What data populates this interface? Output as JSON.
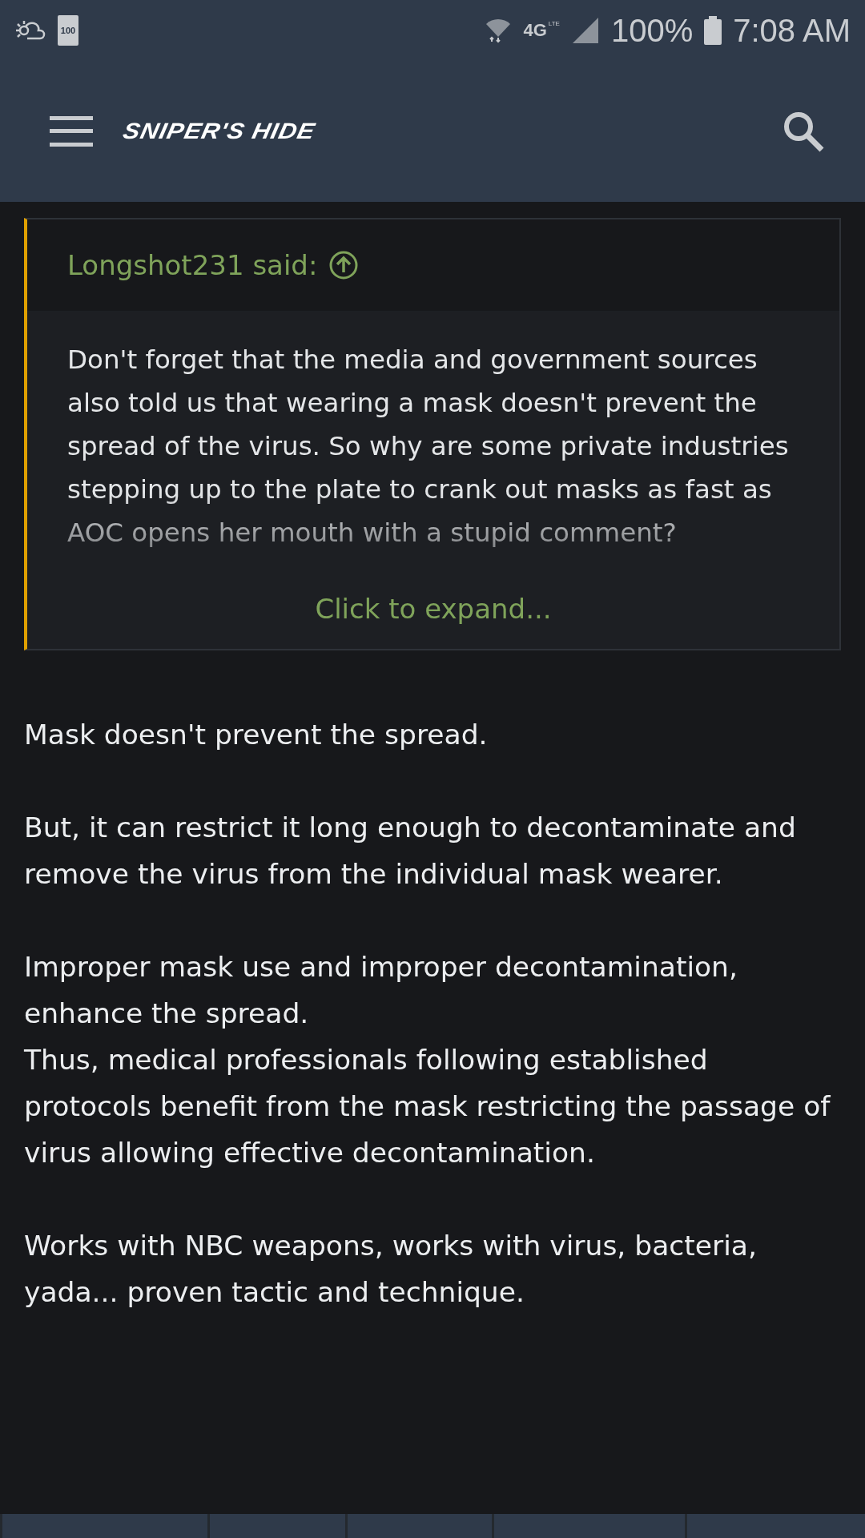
{
  "status_bar": {
    "battery_badge": "100",
    "network": "4G",
    "network_sub": "LTE",
    "battery": "100%",
    "time": "7:08 AM"
  },
  "header": {
    "logo": "SNIPER'S HIDE"
  },
  "quote": {
    "author": "Longshot231 said:",
    "text": "Don't forget that the media and government sources also told us that wearing a mask doesn't prevent the spread of the virus. So why are some private industries stepping up to the plate to crank out masks as fast as AOC opens her mouth with a stupid comment?",
    "expand": "Click to expand..."
  },
  "post": {
    "paragraphs": [
      [
        "Mask doesn't prevent the spread."
      ],
      [
        "But, it can restrict it long enough to decontaminate and remove the virus from the individual mask wearer."
      ],
      [
        "Improper mask use and improper decontamination, enhance the spread.",
        "Thus, medical professionals following established protocols benefit from the mask restricting the passage of virus allowing effective decontamination."
      ],
      [
        "Works with NBC weapons, works with virus, bacteria, yada... proven tactic and technique."
      ]
    ]
  }
}
